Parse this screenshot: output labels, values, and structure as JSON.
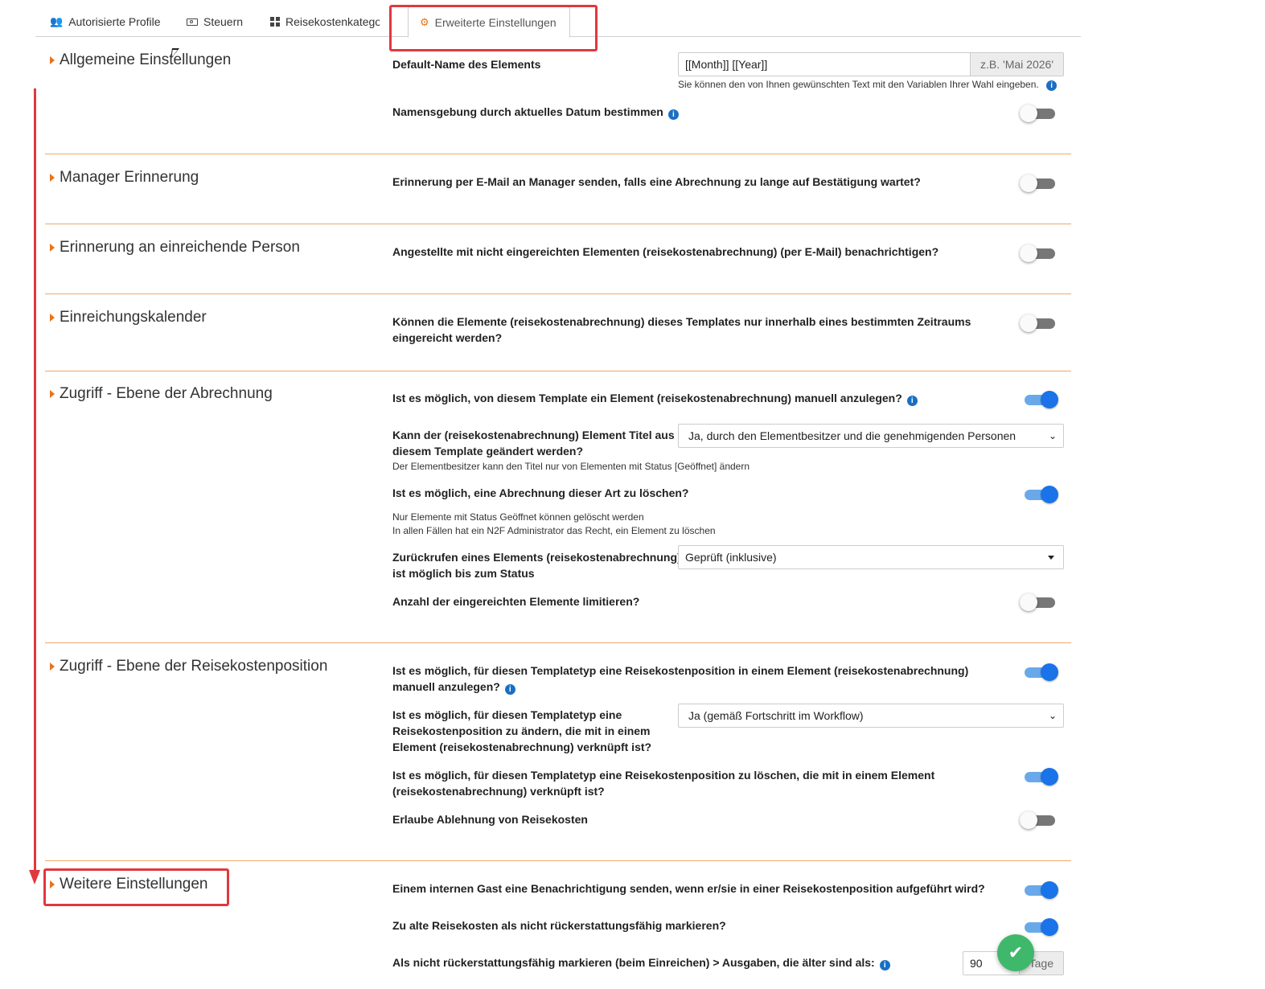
{
  "tabs": [
    {
      "label": "Autorisierte Profile",
      "icon": "users-icon"
    },
    {
      "label": "Steuern",
      "icon": "money-icon"
    },
    {
      "label": "Reisekostenkategorie",
      "icon": "grid-icon"
    },
    {
      "label": "Erweiterte Einstellungen",
      "icon": "gear-icon",
      "active": true
    }
  ],
  "colors": {
    "accent": "#e8731a",
    "highlight": "#e0383e",
    "toggle_on": "#1a73e8",
    "success": "#3fb86b"
  },
  "sections": {
    "allgemein": {
      "title": "Allgemeine Einstellungen",
      "default_name_label": "Default-Name des Elements",
      "default_name_value": "[[Month]] [[Year]]",
      "default_name_addon": "z.B. 'Mai 2026'",
      "default_name_hint": "Sie können den von Ihnen gewünschten Text mit den Variablen Ihrer Wahl eingeben.",
      "naming_by_date_label": "Namensgebung durch aktuelles Datum bestimmen",
      "naming_by_date_on": false
    },
    "manager": {
      "title": "Manager Erinnerung",
      "label": "Erinnerung per E-Mail an Manager senden, falls eine Abrechnung zu lange auf Bestätigung wartet?",
      "on": false
    },
    "submitter": {
      "title": "Erinnerung an einreichende Person",
      "label": "Angestellte mit nicht eingereichten Elementen (reisekostenabrechnung) (per E-Mail) benachrichtigen?",
      "on": false
    },
    "calendar": {
      "title": "Einreichungskalender",
      "label_line1": "Können die Elemente (reisekostenabrechnung) dieses Templates nur innerhalb eines bestimmten Zeitraums",
      "label_line2": "eingereicht werden?",
      "on": false
    },
    "report_access": {
      "title": "Zugriff - Ebene der Abrechnung",
      "manual_create_label": "Ist es möglich, von diesem Template ein Element (reisekostenabrechnung) manuell anzulegen?",
      "manual_create_on": true,
      "title_change_label_line1": "Kann der (reisekostenabrechnung) Element Titel aus",
      "title_change_label_line2": "diesem Template geändert werden?",
      "title_change_value": "Ja, durch den Elementbesitzer und die genehmigenden Personen",
      "title_change_hint": "Der Elementbesitzer kann den Titel nur von Elementen mit Status [Geöffnet] ändern",
      "delete_label": "Ist es möglich, eine Abrechnung dieser Art zu löschen?",
      "delete_on": true,
      "delete_hint_line1": "Nur Elemente mit Status Geöffnet können gelöscht werden",
      "delete_hint_line2": "In allen Fällen hat ein N2F Administrator das Recht, ein Element zu löschen",
      "recall_label_line1": "Zurückrufen eines Elements (reisekostenabrechnung)",
      "recall_label_line2": "ist möglich bis zum Status",
      "recall_value": "Geprüft (inklusive)",
      "limit_label": "Anzahl der eingereichten Elemente limitieren?",
      "limit_on": false
    },
    "expense_access": {
      "title": "Zugriff - Ebene der Reisekostenposition",
      "manual_create_line1": "Ist es möglich, für diesen Templatetyp eine Reisekostenposition in einem Element (reisekostenabrechnung)",
      "manual_create_line2": "manuell anzulegen?",
      "manual_create_on": true,
      "edit_line1": "Ist es möglich, für diesen Templatetyp eine",
      "edit_line2": "Reisekostenposition zu ändern, die mit in einem",
      "edit_line3": "Element (reisekostenabrechnung) verknüpft ist?",
      "edit_value": "Ja (gemäß Fortschritt im Workflow)",
      "delete_line1": "Ist es möglich, für diesen Templatetyp eine Reisekostenposition zu löschen, die mit in einem Element",
      "delete_line2": "(reisekostenabrechnung) verknüpft ist?",
      "delete_on": true,
      "reject_label": "Erlaube Ablehnung von Reisekosten",
      "reject_on": false
    },
    "further": {
      "title": "Weitere Einstellungen",
      "guest_notify_label": "Einem internen Gast eine Benachrichtigung senden, wenn er/sie in einer Reisekostenposition aufgeführt wird?",
      "guest_notify_on": true,
      "old_expenses_label": "Zu alte Reisekosten als nicht rückerstattungsfähig markieren?",
      "old_expenses_on": true,
      "older_than_label": "Als nicht rückerstattungsfähig markieren (beim Einreichen) > Ausgaben, die älter sind als:",
      "older_than_value": "90",
      "older_than_unit": "Tage"
    }
  }
}
